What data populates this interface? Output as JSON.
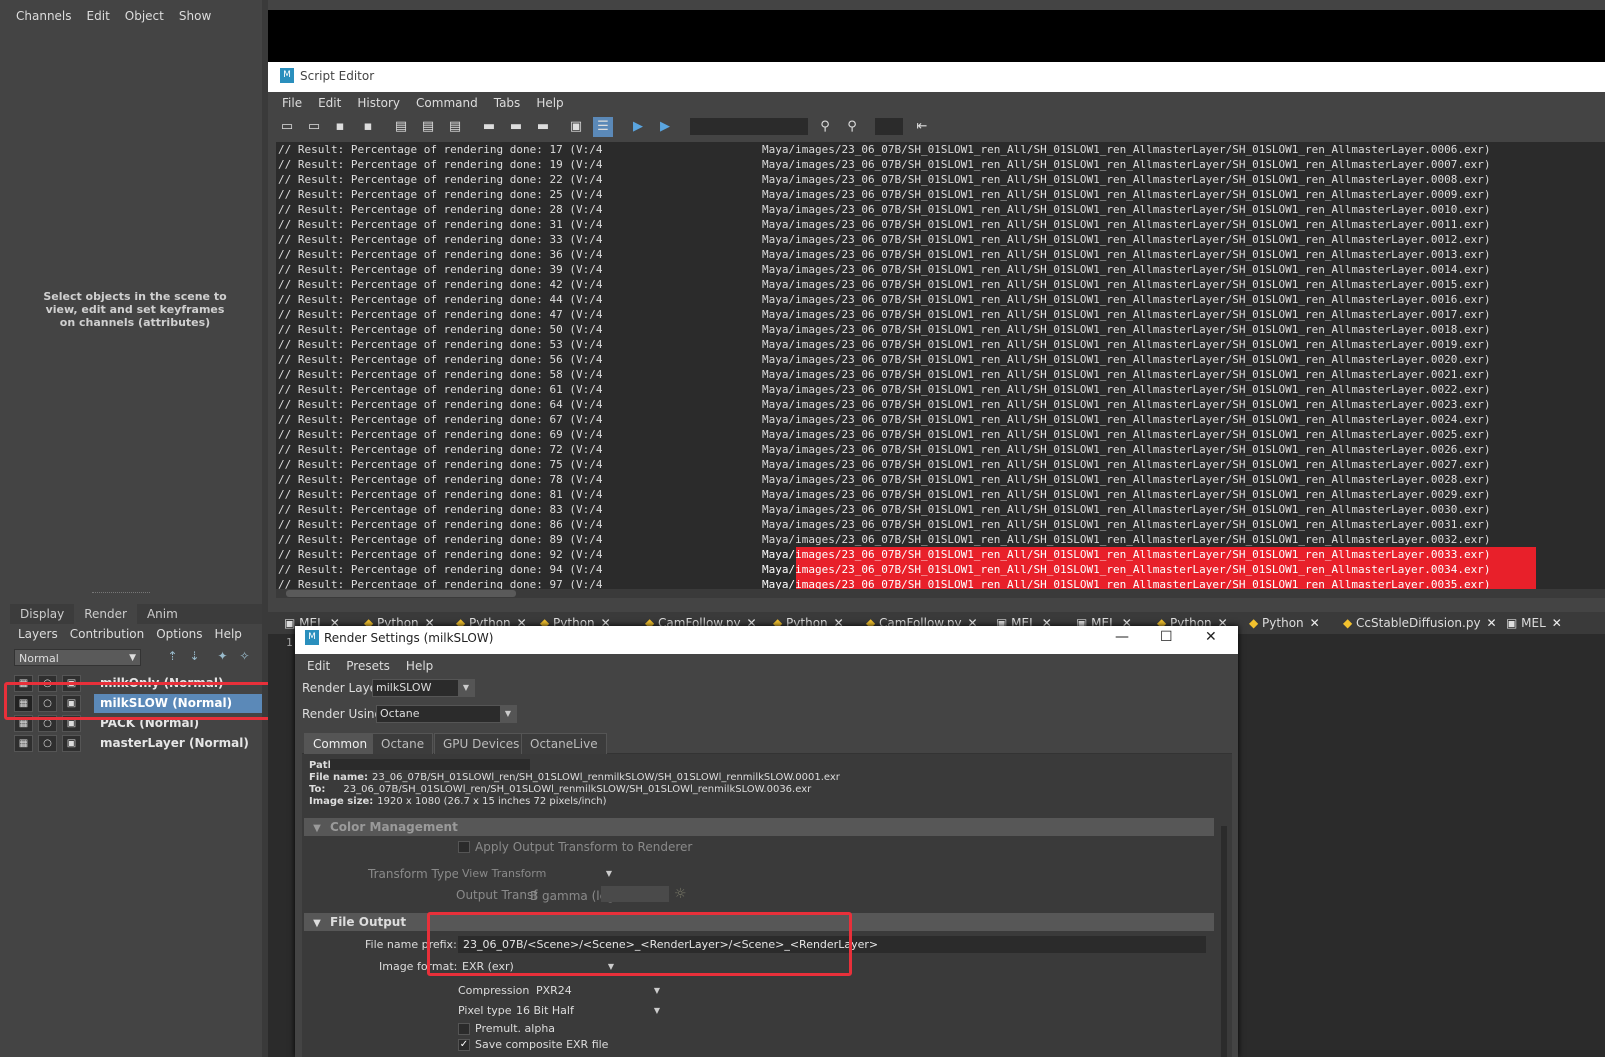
{
  "channel_box": {
    "menu": [
      "Channels",
      "Edit",
      "Object",
      "Show"
    ],
    "hint": "Select objects in the scene to view, edit and set keyframes on channels (attributes)"
  },
  "layer_editor": {
    "tabs": [
      "Display",
      "Render",
      "Anim"
    ],
    "active_tab": "Render",
    "menu": [
      "Layers",
      "Contribution",
      "Options",
      "Help"
    ],
    "blend_mode": "Normal",
    "layers": [
      {
        "name": "milkOnly (Normal)"
      },
      {
        "name": "milkSLOW (Normal)",
        "selected": true
      },
      {
        "name": "PACK (Normal)"
      },
      {
        "name": "masterLayer (Normal)"
      }
    ]
  },
  "script_editor": {
    "title": "Script Editor",
    "menu": [
      "File",
      "Edit",
      "History",
      "Command",
      "Tabs",
      "Help"
    ],
    "line_prefix": "// Result: Percentage of rendering done:",
    "path_left_fragment": "(V:/4",
    "path_right_prefix": "Maya/images/23_06_07B/SH_01SLOW1_ren_All/SH_01SLOW1_ren_AllmasterLayer/SH_01SLOW1_ren_AllmasterLayer.",
    "lines": [
      {
        "pct": "17",
        "frame": "0006.exr)"
      },
      {
        "pct": "19",
        "frame": "0007.exr)"
      },
      {
        "pct": "22",
        "frame": "0008.exr)"
      },
      {
        "pct": "25",
        "frame": "0009.exr)"
      },
      {
        "pct": "28",
        "frame": "0010.exr)"
      },
      {
        "pct": "31",
        "frame": "0011.exr)"
      },
      {
        "pct": "33",
        "frame": "0012.exr)"
      },
      {
        "pct": "36",
        "frame": "0013.exr)"
      },
      {
        "pct": "39",
        "frame": "0014.exr)"
      },
      {
        "pct": "42",
        "frame": "0015.exr)"
      },
      {
        "pct": "44",
        "frame": "0016.exr)"
      },
      {
        "pct": "47",
        "frame": "0017.exr)"
      },
      {
        "pct": "50",
        "frame": "0018.exr)"
      },
      {
        "pct": "53",
        "frame": "0019.exr)"
      },
      {
        "pct": "56",
        "frame": "0020.exr)"
      },
      {
        "pct": "58",
        "frame": "0021.exr)"
      },
      {
        "pct": "61",
        "frame": "0022.exr)"
      },
      {
        "pct": "64",
        "frame": "0023.exr)"
      },
      {
        "pct": "67",
        "frame": "0024.exr)"
      },
      {
        "pct": "69",
        "frame": "0025.exr)"
      },
      {
        "pct": "72",
        "frame": "0026.exr)"
      },
      {
        "pct": "75",
        "frame": "0027.exr)"
      },
      {
        "pct": "78",
        "frame": "0028.exr)"
      },
      {
        "pct": "81",
        "frame": "0029.exr)"
      },
      {
        "pct": "83",
        "frame": "0030.exr)"
      },
      {
        "pct": "86",
        "frame": "0031.exr)"
      },
      {
        "pct": "89",
        "frame": "0032.exr)"
      },
      {
        "pct": "92",
        "frame": "0033.exr)",
        "highlight": true
      },
      {
        "pct": "94",
        "frame": "0034.exr)",
        "highlight": true
      },
      {
        "pct": "97",
        "frame": "0035.exr)",
        "highlight": true
      }
    ],
    "tabs": [
      {
        "label": "MEL",
        "kind": "mel"
      },
      {
        "label": "Python",
        "kind": "py"
      },
      {
        "label": "Python",
        "kind": "py"
      },
      {
        "label": "Python",
        "kind": "py"
      },
      {
        "label": "CamFollow.py",
        "kind": "py"
      },
      {
        "label": "Python",
        "kind": "py"
      },
      {
        "label": "CamFollow.py",
        "kind": "py"
      },
      {
        "label": "MEL",
        "kind": "mel"
      },
      {
        "label": "MEL",
        "kind": "mel"
      },
      {
        "label": "Python",
        "kind": "py"
      },
      {
        "label": "Python",
        "kind": "py"
      },
      {
        "label": "CcStableDiffusion.py",
        "kind": "py"
      },
      {
        "label": "MEL",
        "kind": "mel"
      }
    ],
    "input_line_number": "1"
  },
  "render_settings": {
    "title": "Render Settings (milkSLOW)",
    "menu": [
      "Edit",
      "Presets",
      "Help"
    ],
    "render_layer_label": "Render Layer",
    "render_layer": "milkSLOW",
    "render_using_label": "Render Using",
    "render_using": "Octane",
    "tabs": [
      "Common",
      "Octane",
      "GPU Devices",
      "OctaneLive"
    ],
    "active_tab": "Common",
    "path_label": "Path:",
    "file_name_label": "File name:",
    "file_name": "23_06_07B/SH_01SLOWl_ren/SH_01SLOWl_renmilkSLOW/SH_01SLOWl_renmilkSLOW.0001.exr",
    "to_label": "To:",
    "to": "23_06_07B/SH_01SLOWl_ren/SH_01SLOWl_renmilkSLOW/SH_01SLOWl_renmilkSLOW.0036.exr",
    "image_size_label": "Image size:",
    "image_size": "1920 x 1080 (26.7 x 15 inches 72 pixels/inch)",
    "color_management": {
      "header": "Color Management",
      "apply_output_transform": "Apply Output Transform to Renderer",
      "transform_type_label": "Transform Type:",
      "transform_type": "View Transform",
      "output_transform_label": "Output Transf",
      "output_transform": "B gamma (leg"
    },
    "file_output": {
      "header": "File Output",
      "prefix_label": "File name prefix:",
      "prefix": "23_06_07B/<Scene>/<Scene>_<RenderLayer>/<Scene>_<RenderLayer>",
      "format_label": "Image format:",
      "format": "EXR (exr)",
      "compression_label": "Compression",
      "compression": "PXR24",
      "pixel_type_label": "Pixel type",
      "pixel_type": "16 Bit Half",
      "premult_label": "Premult. alpha",
      "premult": false,
      "save_composite_label": "Save composite EXR file",
      "save_composite": true
    }
  },
  "colors": {
    "highlight_red": "#e8202a",
    "annotation_red": "#e8303a",
    "selected_layer": "#5b89b8"
  }
}
